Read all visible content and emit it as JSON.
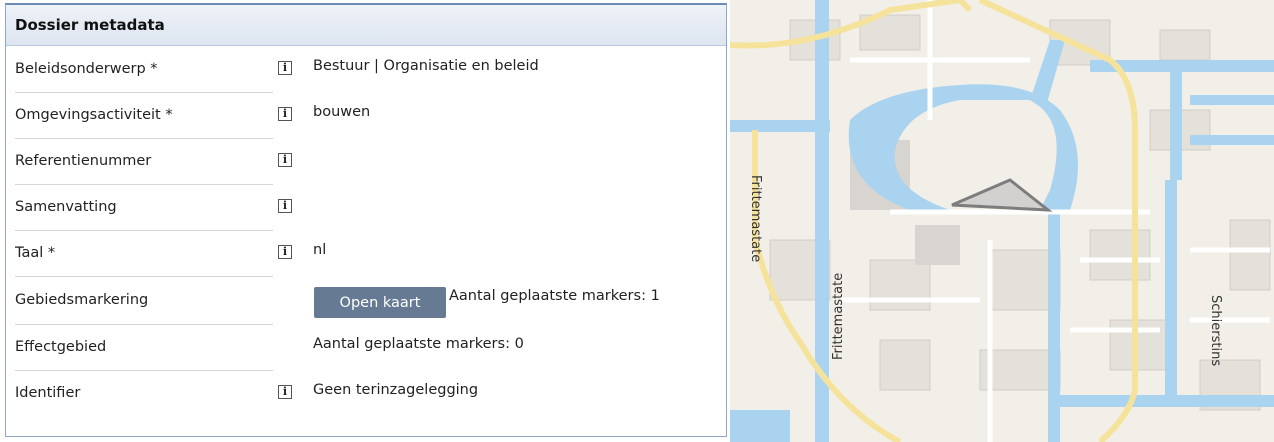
{
  "panel": {
    "title": "Dossier metadata",
    "rows": [
      {
        "label": "Beleidsonderwerp *",
        "has_info": true,
        "value": "Bestuur | Organisatie en beleid"
      },
      {
        "label": "Omgevingsactiviteit *",
        "has_info": true,
        "value": "bouwen"
      },
      {
        "label": "Referentienummer",
        "has_info": true,
        "value": ""
      },
      {
        "label": "Samenvatting",
        "has_info": true,
        "value": ""
      },
      {
        "label": "Taal *",
        "has_info": true,
        "value": "nl"
      },
      {
        "label": "Gebiedsmarkering",
        "has_info": false,
        "button": "Open kaart",
        "value": "Aantal geplaatste markers: 1"
      },
      {
        "label": "Effectgebied",
        "has_info": false,
        "value": "Aantal geplaatste markers: 0"
      },
      {
        "label": "Identifier",
        "has_info": true,
        "value": "Geen terinzagelegging"
      }
    ],
    "info_glyph": "i"
  },
  "map": {
    "street_labels": [
      "Frittemastate",
      "Frittemastate",
      "Schierstins"
    ],
    "colors": {
      "water": "#a9d3ee",
      "land": "#f2efe9",
      "road": "#ffffff",
      "major_road": "#f6e39b",
      "polygon": "#8a8a8a"
    }
  }
}
